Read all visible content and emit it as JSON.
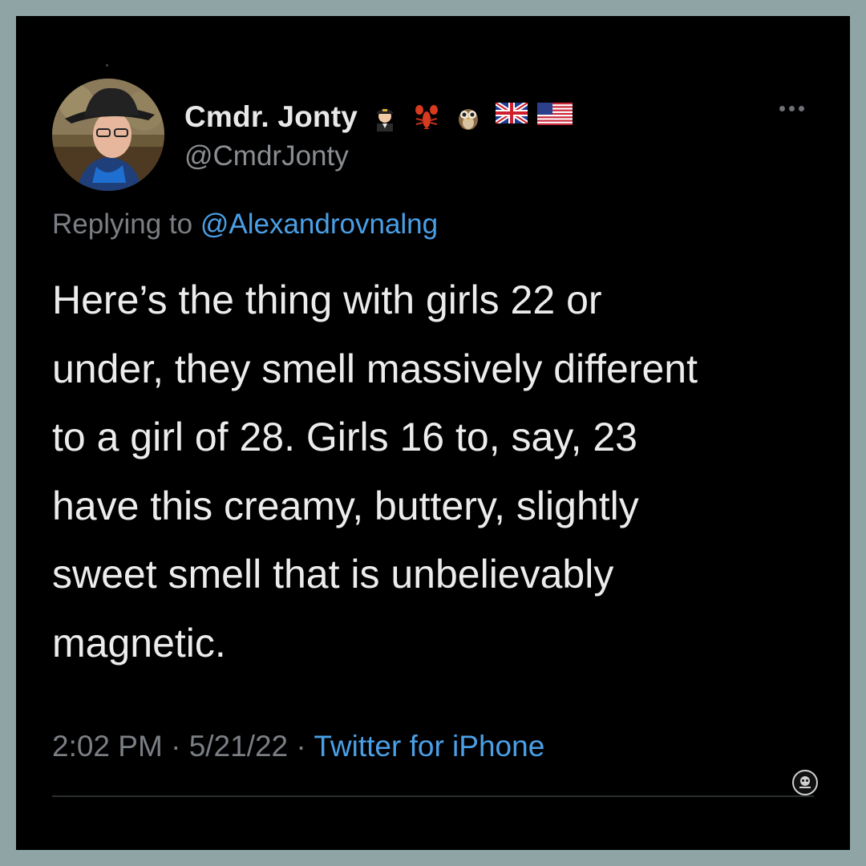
{
  "author": {
    "display_name": "Cmdr. Jonty",
    "handle": "@CmdrJonty",
    "name_emojis": [
      "pilot-emoji",
      "lobster-emoji",
      "owl-emoji",
      "uk-flag-emoji",
      "us-flag-emoji"
    ]
  },
  "reply": {
    "prefix": "Replying to",
    "mention": "@Alexandrovnalng"
  },
  "tweet": {
    "lines": [
      "Here’s the thing with girls 22 or",
      "under, they smell massively different",
      "to a girl of 28. Girls 16 to, say, 23",
      "have this creamy, buttery,  slightly",
      "sweet smell that is unbelievably",
      "magnetic."
    ]
  },
  "meta": {
    "time": "2:02 PM",
    "separator": " · ",
    "date": "5/21/22",
    "client": "Twitter for iPhone"
  },
  "colors": {
    "background": "#000000",
    "frame": "#8ea4a5",
    "link": "#4a9fe6",
    "text": "#ececec",
    "muted": "#7b7f84"
  }
}
